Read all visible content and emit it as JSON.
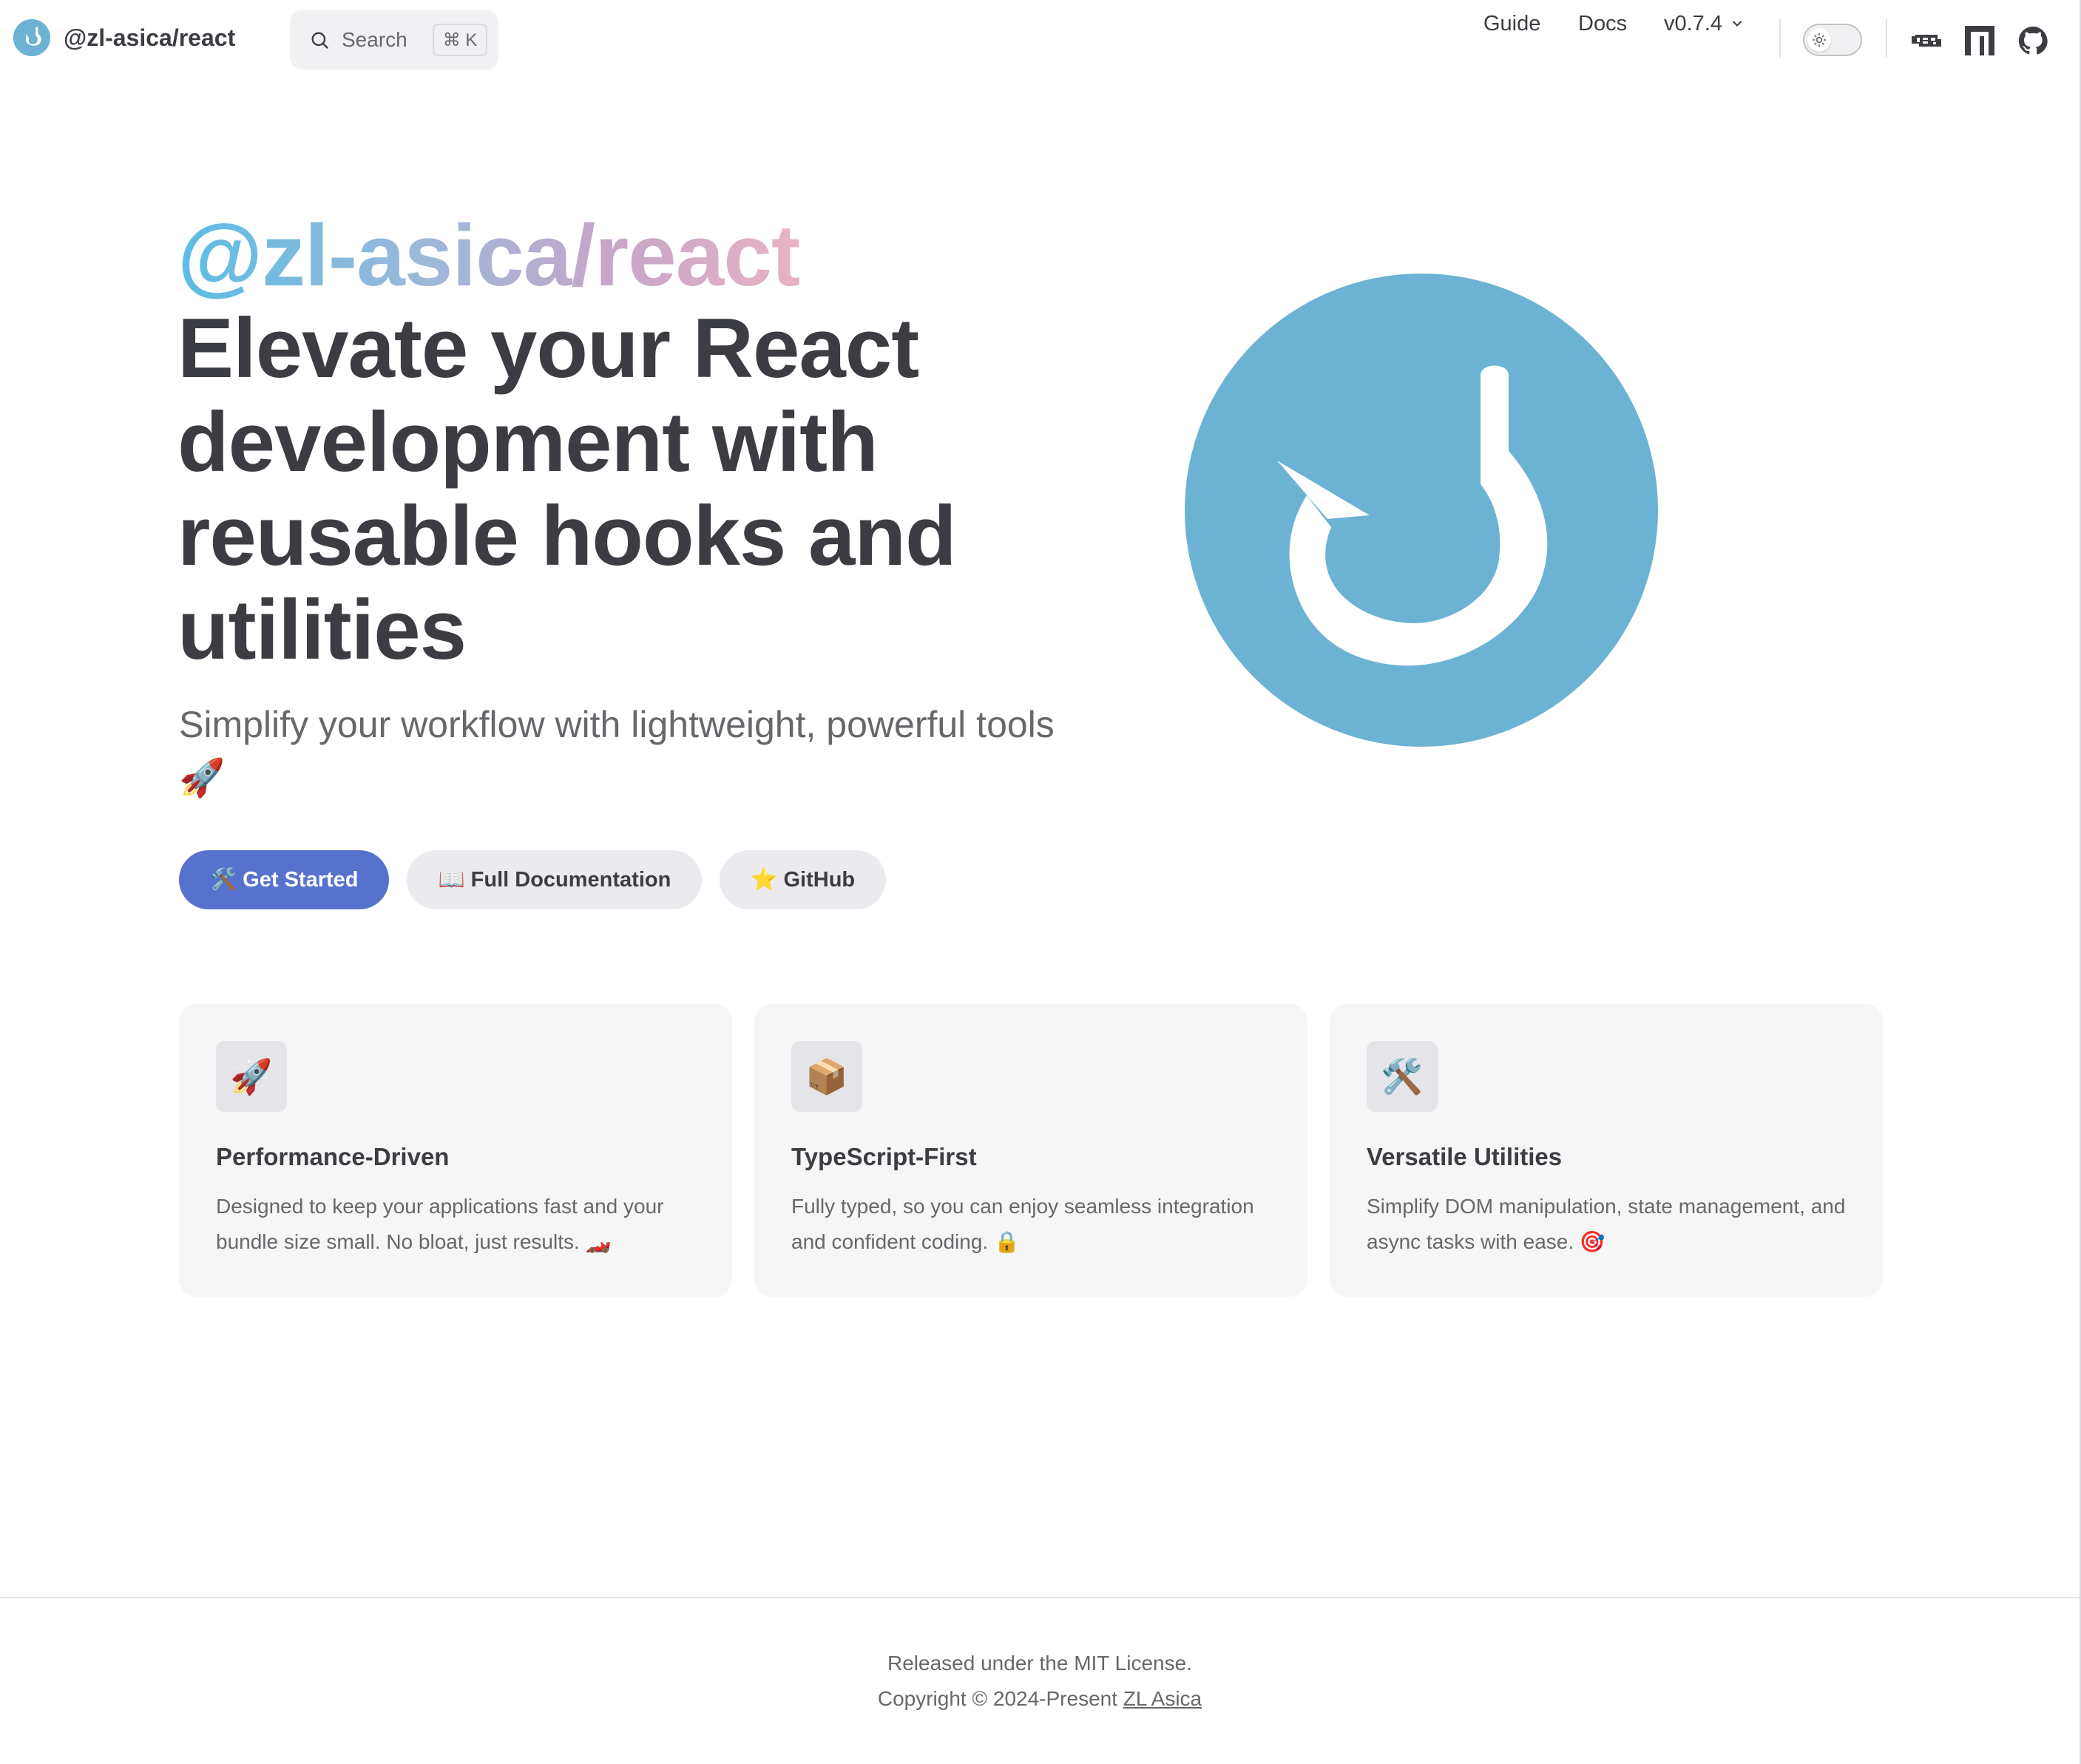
{
  "nav": {
    "brand_title": "@zl-asica/react",
    "search": {
      "label": "Search",
      "shortcut": "⌘ K"
    },
    "links": {
      "guide": "Guide",
      "docs": "Docs",
      "version": "v0.7.4"
    },
    "icons": [
      "sun-icon",
      "npm-icon",
      "jsr-icon",
      "github-icon"
    ]
  },
  "hero": {
    "name": "@zl-asica/react",
    "text": "Elevate your React development with reusable hooks and utilities",
    "tagline": "Simplify your workflow with lightweight, powerful tools 🚀",
    "actions": {
      "get_started": "🛠️ Get Started",
      "full_docs": "📖 Full Documentation",
      "github": "⭐ GitHub"
    }
  },
  "features": [
    {
      "icon": "🚀",
      "title": "Performance-Driven",
      "details": "Designed to keep your applications fast and your bundle size small. No bloat, just results. 🏎️"
    },
    {
      "icon": "📦",
      "title": "TypeScript-First",
      "details": "Fully typed, so you can enjoy seamless integration and confident coding. 🔒"
    },
    {
      "icon": "🛠️",
      "title": "Versatile Utilities",
      "details": "Simplify DOM manipulation, state management, and async tasks with ease. 🎯"
    }
  ],
  "footer": {
    "message": "Released under the MIT License.",
    "copyright_prefix": "Copyright © 2024-Present",
    "copyright_link": "ZL Asica"
  },
  "colors": {
    "brand": "#6cb2d2",
    "primary_button": "#5672cd",
    "text": "#3c3c43",
    "muted_text": "#67676c"
  }
}
